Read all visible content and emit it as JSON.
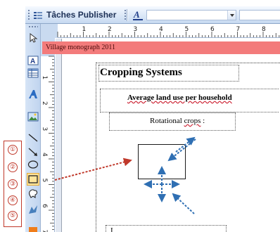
{
  "toolbar": {
    "title": "Tâches Publisher",
    "font_combo_value": "",
    "size_combo_value": ""
  },
  "header": {
    "band_text": "Village monograph 2011"
  },
  "document": {
    "title": "Cropping Systems",
    "subtitle": "Average land use per household",
    "rotational_prefix": "Rotational ",
    "rotational_misspelled": "crops",
    "rotational_suffix": " :",
    "bottom_fragment": "I        "
  },
  "ruler": {
    "h_numbers": [
      "1",
      "2",
      "3",
      "4",
      "5",
      "6",
      "7",
      "8"
    ],
    "v_numbers": [
      "1",
      "2",
      "3",
      "4",
      "5",
      "6",
      "7"
    ]
  },
  "callouts": {
    "labels": [
      "①",
      "②",
      "③",
      "④",
      "⑤"
    ]
  },
  "tools": {
    "selected": "rectangle-tool"
  },
  "colors": {
    "header_band": "#f37b7b",
    "callout_red": "#c0392b",
    "arrow_blue": "#2f6fb3",
    "toolbar_blue": "#c6d9f1"
  }
}
